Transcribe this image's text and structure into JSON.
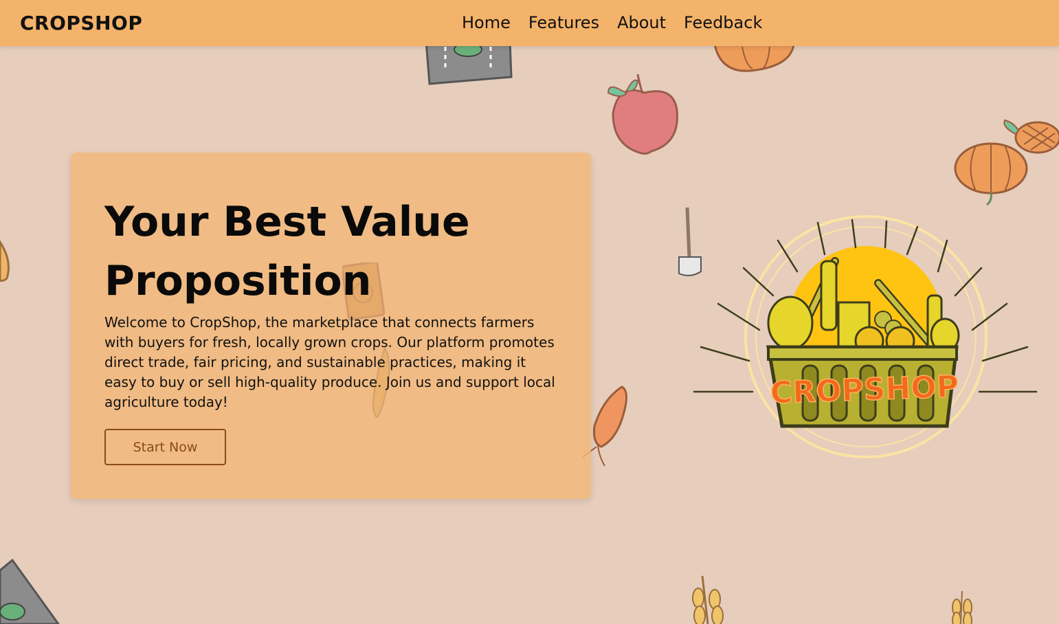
{
  "nav": {
    "brand": "CROPSHOP",
    "links": [
      "Home",
      "Features",
      "About",
      "Feedback"
    ]
  },
  "hero": {
    "title_line1": "Your Best Value",
    "title_line2": "Proposition",
    "description": "Welcome to CropShop, the marketplace that connects farmers with buyers for fresh, locally grown crops. Our platform promotes direct trade, fair pricing, and sustainable practices, making it easy to buy or sell high-quality produce. Join us and support local agriculture today!",
    "cta_label": "Start Now"
  },
  "logo": {
    "text": "CROPSHOP"
  },
  "colors": {
    "background": "#e6cdbc",
    "navbar": "#f4b36a",
    "card": "#f1b778",
    "button_border": "#8a4a1e",
    "logo_text": "#f26a1b",
    "basket": "#b8b030",
    "sun": "#ffc412"
  },
  "icons": [
    "seed-packet-icon",
    "pumpkin-icon",
    "apple-icon",
    "pineapple-icon",
    "shovel-icon",
    "carrot-icon",
    "wheat-icon",
    "corn-icon"
  ]
}
